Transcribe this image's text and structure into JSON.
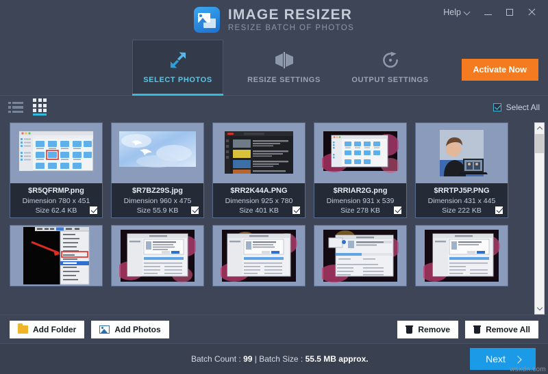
{
  "window": {
    "title": "IMAGE RESIZER",
    "subtitle": "RESIZE BATCH OF PHOTOS",
    "logo_icon": "image-stack-icon",
    "help_label": "Help",
    "help_chevron_icon": "chevron-down-icon",
    "minimize_icon": "minimize-icon",
    "maximize_icon": "maximize-icon",
    "close_icon": "close-icon",
    "accent": "#34bcdc",
    "background": "#3d4556"
  },
  "tabs": [
    {
      "label": "SELECT PHOTOS",
      "icon": "resize-arrows-icon",
      "active": true
    },
    {
      "label": "RESIZE SETTINGS",
      "icon": "mirror-flip-icon",
      "active": false
    },
    {
      "label": "OUTPUT SETTINGS",
      "icon": "refresh-circle-icon",
      "active": false
    }
  ],
  "activate": {
    "label": "Activate Now",
    "color": "#f47b20"
  },
  "toolbar": {
    "list_view_icon": "list-view-icon",
    "grid_view_icon": "grid-view-icon",
    "active_view": "grid",
    "select_all_label": "Select All",
    "select_all_checked": true
  },
  "photos": [
    {
      "name": "$R5QFRMP.png",
      "dimension": "Dimension 780 x 451",
      "size": "Size 62.4 KB",
      "checked": true,
      "thumb": "finder-folders"
    },
    {
      "name": "$R7BZ29S.jpg",
      "dimension": "Dimension 960 x 475",
      "size": "Size 55.9 KB",
      "checked": true,
      "thumb": "sky-birds"
    },
    {
      "name": "$RR2K44A.PNG",
      "dimension": "Dimension 925 x 780",
      "size": "Size 401 KB",
      "checked": true,
      "thumb": "video-site"
    },
    {
      "name": "$RRIAR2G.png",
      "dimension": "Dimension 931 x 539",
      "size": "Size 278 KB",
      "checked": true,
      "thumb": "finder-on-wallpaper"
    },
    {
      "name": "$RRTPJ5P.PNG",
      "dimension": "Dimension 431 x 445",
      "size": "Size 222 KB",
      "checked": true,
      "thumb": "video-call"
    },
    {
      "name": "",
      "dimension": "",
      "size": "",
      "checked": false,
      "thumb": "menu-redarrow"
    },
    {
      "name": "",
      "dimension": "",
      "size": "",
      "checked": false,
      "thumb": "installer-dialog"
    },
    {
      "name": "",
      "dimension": "",
      "size": "",
      "checked": false,
      "thumb": "installer-dialog"
    },
    {
      "name": "",
      "dimension": "",
      "size": "",
      "checked": false,
      "thumb": "installer-dialog"
    },
    {
      "name": "",
      "dimension": "",
      "size": "",
      "checked": false,
      "thumb": "installer-dialog"
    }
  ],
  "actions": {
    "add_folder_label": "Add Folder",
    "add_folder_icon": "folder-icon",
    "add_photos_label": "Add Photos",
    "add_photos_icon": "photo-icon",
    "remove_label": "Remove",
    "remove_icon": "trash-icon",
    "remove_all_label": "Remove All",
    "remove_all_icon": "trash-icon"
  },
  "status": {
    "batch_count_label": "Batch Count :",
    "batch_count_value": "99",
    "separator": "|",
    "batch_size_label": "Batch Size :",
    "batch_size_value": "55.5 MB approx.",
    "next_label": "Next",
    "next_icon": "chevron-right-icon",
    "watermark": "wsxdn.com"
  },
  "scrollbar": {
    "up_icon": "chevron-up-icon",
    "down_icon": "chevron-down-icon"
  }
}
